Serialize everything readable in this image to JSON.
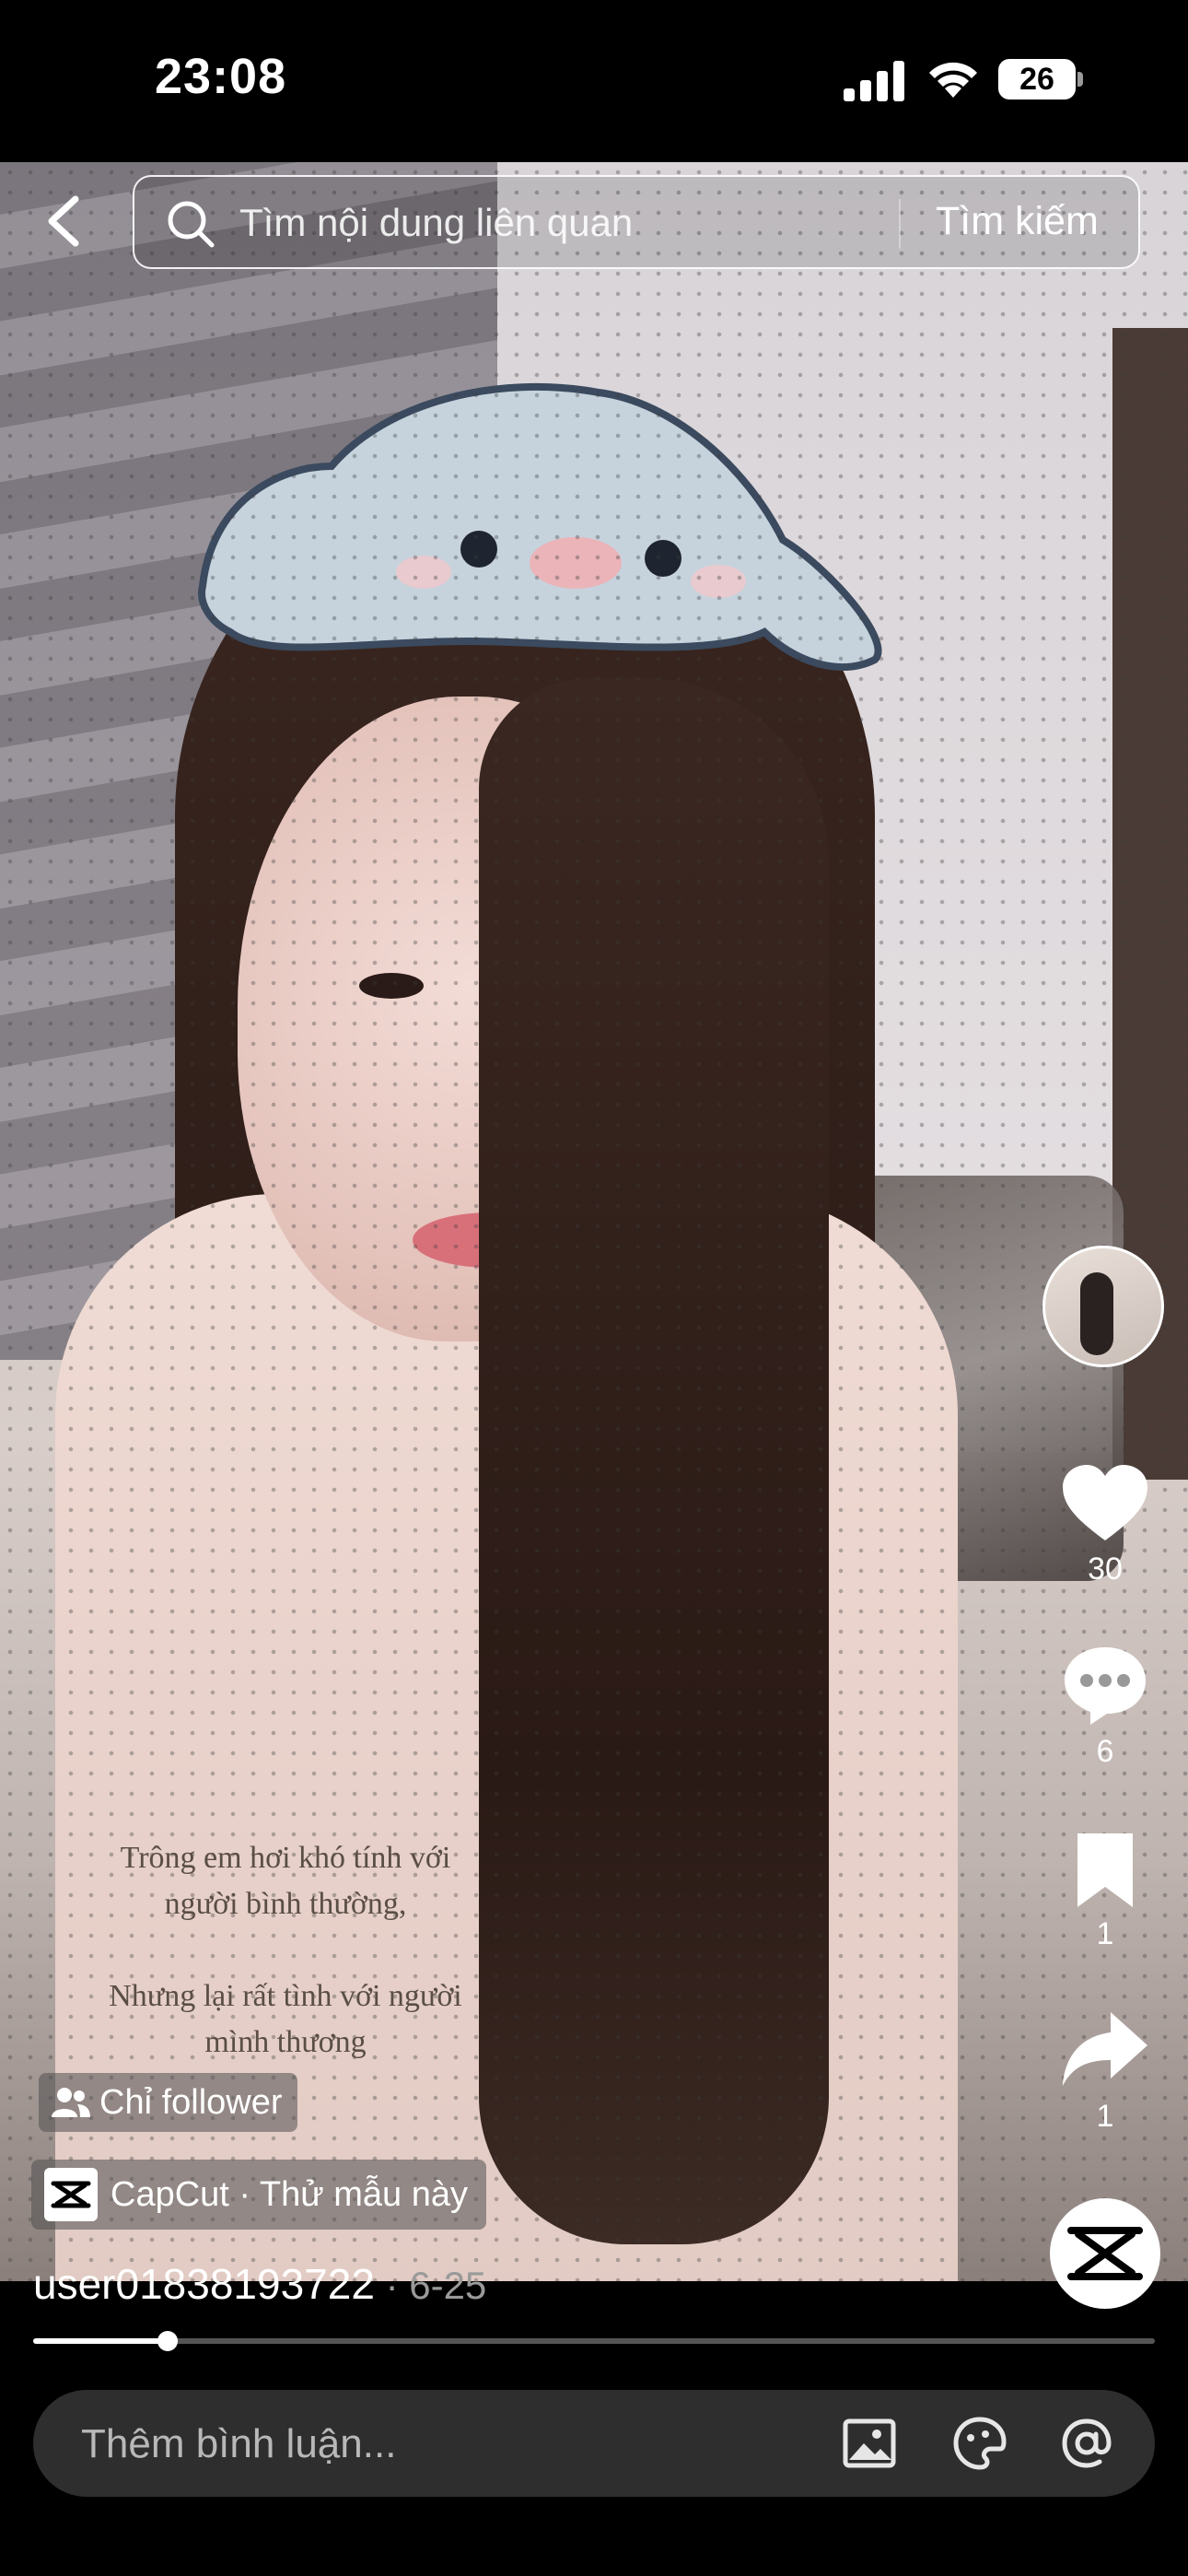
{
  "status_bar": {
    "time": "23:08",
    "battery": "26"
  },
  "search": {
    "placeholder": "Tìm nội dung liên quan",
    "button_label": "Tìm kiếm"
  },
  "video": {
    "caption_lines": [
      "Trông em hơi khó tính với",
      "người bình thường,",
      "Nhưng lại rất tình với người",
      "mình thương"
    ],
    "audience_label": "Chỉ follower",
    "template_label": "CapCut · Thử mẫu này",
    "username": "user01838193722",
    "date": " · 6-25",
    "progress": 0.12
  },
  "actions": {
    "likes": "30",
    "comments": "6",
    "saves": "1",
    "shares": "1"
  },
  "comment_bar": {
    "placeholder": "Thêm bình luận..."
  },
  "icons": {
    "back": "chevron-left-icon",
    "search": "search-icon",
    "like": "heart-icon",
    "comment": "comment-icon",
    "save": "bookmark-icon",
    "share": "share-icon",
    "image": "image-icon",
    "emoji": "emoji-icon",
    "mention": "at-sign-icon"
  }
}
